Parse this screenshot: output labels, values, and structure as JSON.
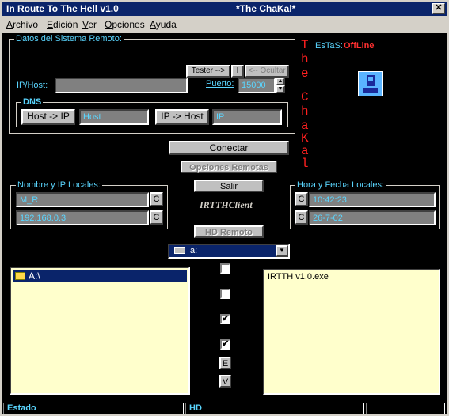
{
  "window": {
    "title_left": "In Route To The Hell v1.0",
    "title_center": "*The ChaKal*",
    "close_glyph": "✕"
  },
  "menu": [
    "Archivo",
    "Edición",
    "Ver",
    "Opciones",
    "Ayuda"
  ],
  "remote": {
    "group_label": "Datos del Sistema Remoto:",
    "tester_button": "Tester -->",
    "i_button": "I",
    "ocultar_button": "<-- Ocultar",
    "ip_host_label": "IP/Host:",
    "ip_host_value": "",
    "puerto_label": "Puerto:",
    "puerto_value": "15000",
    "dns_label": "DNS",
    "host_to_ip_button": "Host -> IP",
    "host_field": "Host",
    "ip_to_host_button": "IP -> Host",
    "ip_field": "IP"
  },
  "sidebar": {
    "letters": [
      "T",
      "h",
      "e",
      "C",
      "h",
      "a",
      "K",
      "a",
      "l"
    ],
    "estas_label": "EsTaS:",
    "status_value": "OffLine"
  },
  "center": {
    "conectar": "Conectar",
    "opciones_remotas": "Opciones Remotas",
    "salir": "Salir",
    "client_label": "IRTTHClient",
    "hd_remoto": "HD Remoto",
    "drive_value": "a:"
  },
  "local": {
    "group_label": "Nombre y IP Locales:",
    "name_value": "M_R",
    "ip_value": "192.168.0.3",
    "c_button": "C"
  },
  "time": {
    "group_label": "Hora y Fecha Locales:",
    "time_value": "10:42:23",
    "date_value": "26-7-02",
    "c_button": "C"
  },
  "left_panel": {
    "folder": "A:\\"
  },
  "right_panel": {
    "file": "IRTTH v1.0.exe"
  },
  "checks": {
    "c1": "",
    "c2": "",
    "c3": "✔",
    "c4": "✔",
    "e_button": "E",
    "v_button": "V"
  },
  "status": {
    "estado": "Estado",
    "hd": "HD"
  }
}
